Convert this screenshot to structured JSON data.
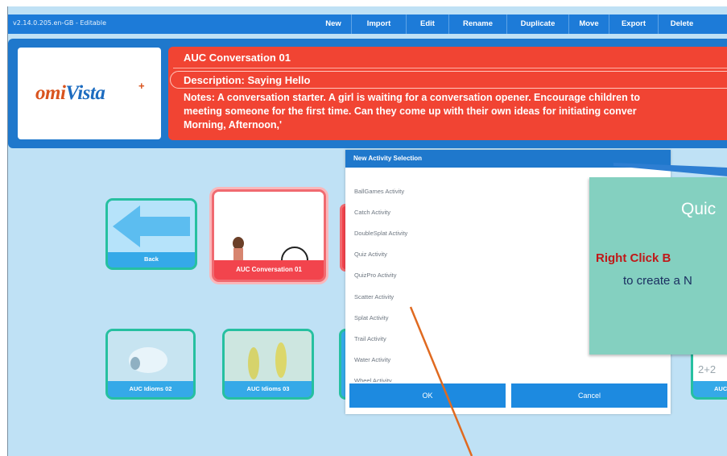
{
  "window": {
    "version_label": "v2.14.0.205.en-GB - Editable"
  },
  "toolbar": {
    "buttons": [
      "New",
      "Import",
      "Edit",
      "Rename",
      "Duplicate",
      "Move",
      "Export",
      "Delete"
    ]
  },
  "logo": {
    "part1": "omi",
    "part2": "Vista",
    "plus": "+",
    "brand": "omiVista+"
  },
  "header": {
    "title": "AUC Conversation 01",
    "description": "Description: Saying Hello",
    "notes_line1": "Notes: A conversation starter. A girl is waiting for a conversation opener. Encourage children to",
    "notes_line2": "meeting someone for the first time.  Can they come up with their own ideas for initiating conver",
    "notes_line3": "Morning, Afternoon,'"
  },
  "tiles": {
    "back_label": "Back",
    "selected_label": "AUC Conversation 01",
    "row2": [
      "AUC Idioms 02",
      "AUC Idioms 03"
    ],
    "partial_right_label": "AUC",
    "partial_right_text": "2+2"
  },
  "dialog": {
    "title": "New Activity Selection",
    "activities": [
      "BallGames Activity",
      "Catch Activity",
      "DoubleSplat Activity",
      "Quiz Activity",
      "QuizPro Activity",
      "Scatter Activity",
      "Splat Activity",
      "Trail Activity",
      "Water Activity",
      "Wheel Activity"
    ],
    "ok_label": "OK",
    "cancel_label": "Cancel"
  },
  "quick_tip": {
    "title": "Quic",
    "line1": "Right Click B",
    "line2": "to create a N"
  },
  "colors": {
    "accent_blue": "#1f78cc",
    "header_red": "#f14433",
    "tile_green": "#26c0a0",
    "tip_teal": "#84d0c0",
    "annotation_orange": "#e06a20",
    "background": "#bfe1f5"
  }
}
